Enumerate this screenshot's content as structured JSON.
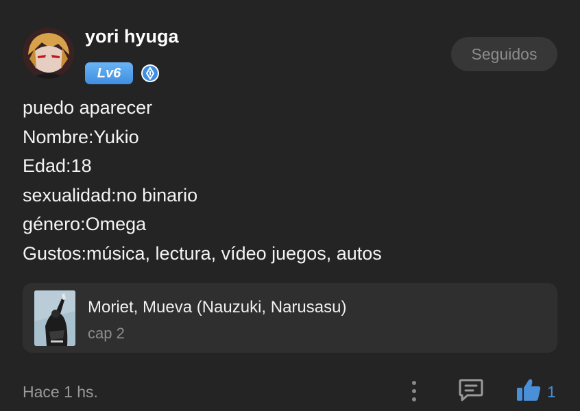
{
  "author": {
    "username": "yori hyuga",
    "level_label": "Lv6",
    "verified_icon": "verified-badge-icon"
  },
  "follow_button": {
    "label": "Seguidos"
  },
  "post": {
    "lines": [
      "puedo aparecer",
      "Nombre:Yukio",
      "Edad:18",
      "sexualidad:no binario",
      "género:Omega",
      "Gustos:música, lectura, vídeo juegos, autos"
    ]
  },
  "linked_story": {
    "title": "Moriet, Mueva (Nauzuki, Narusasu)",
    "subtitle": "cap 2"
  },
  "footer": {
    "timestamp": "Hace 1 hs.",
    "like_count": "1",
    "icons": [
      "more-vertical-icon",
      "comment-icon",
      "thumbs-up-icon"
    ]
  },
  "colors": {
    "background": "#242424",
    "card": "#2f2f2f",
    "accent_blue": "#4a8fd8",
    "level_badge": "#4f9ee8"
  }
}
